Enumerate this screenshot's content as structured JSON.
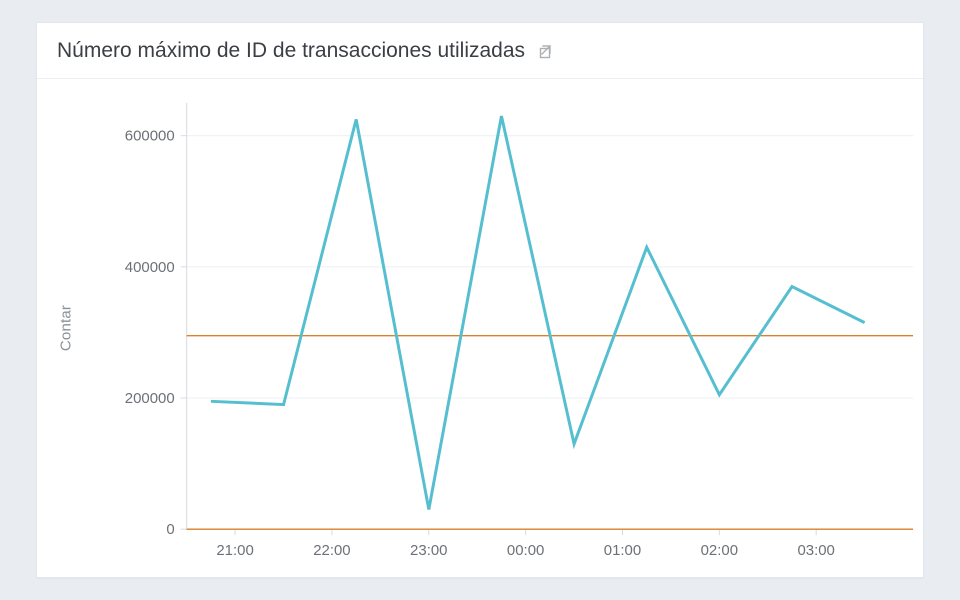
{
  "header": {
    "title": "Número máximo de ID de transacciones utilizadas",
    "open_icon": "open-external-icon"
  },
  "chart_data": {
    "type": "line",
    "ylabel": "Contar",
    "xlabel": "",
    "ylim": [
      0,
      650000
    ],
    "y_ticks": [
      0,
      200000,
      400000,
      600000
    ],
    "x_ticks": [
      "21:00",
      "22:00",
      "23:00",
      "00:00",
      "01:00",
      "02:00",
      "03:00"
    ],
    "x_tick_positions": [
      1,
      3,
      5,
      7,
      9,
      11,
      13
    ],
    "x_count": 15,
    "series": [
      {
        "name": "count",
        "values": [
          195000,
          190000,
          625000,
          30000,
          630000,
          130000,
          430000,
          205000,
          370000,
          315000
        ]
      }
    ],
    "series_x_start": 0.5,
    "series_x_step": 1.5,
    "reference_lines": [
      0,
      295000
    ]
  }
}
